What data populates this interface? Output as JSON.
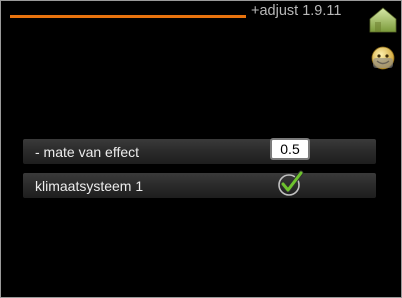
{
  "header": {
    "title": "+adjust 1.9.11",
    "accent_color": "#e8730e",
    "icons": [
      "home-icon",
      "smiley-face-icon"
    ]
  },
  "settings": {
    "rows": [
      {
        "label": "- mate van effect",
        "value": "0.5",
        "control": "number-value"
      },
      {
        "label": "klimaatsysteem 1",
        "checked": true,
        "control": "checkbox",
        "icon": "checkmark-icon"
      }
    ]
  }
}
